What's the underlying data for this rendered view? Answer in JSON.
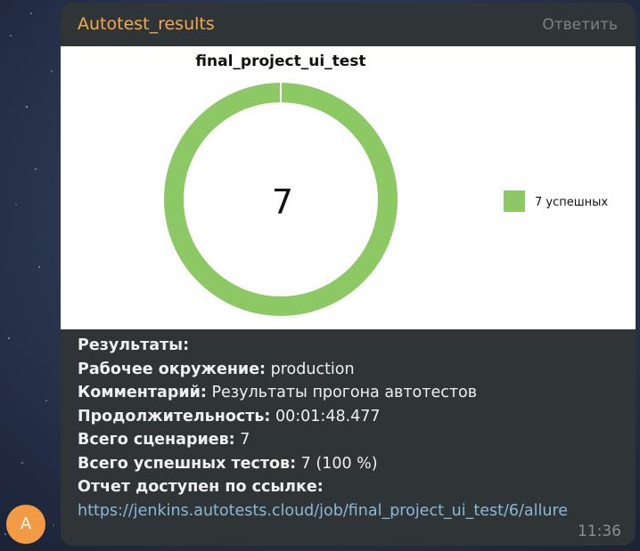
{
  "message": {
    "sender": "Autotest_results",
    "reply_label": "Ответить",
    "time": "11:36",
    "avatar_letter": "A",
    "avatar_color": "#f39a44",
    "sender_color": "#f4a94c"
  },
  "chart_data": {
    "type": "pie",
    "title": "final_project_ui_test",
    "center_label": "7",
    "series": [
      {
        "name": "7 успешных",
        "values": [
          7
        ],
        "color": "#8cc864"
      }
    ],
    "legend": [
      "7 успешных"
    ],
    "legend_position": "right"
  },
  "report": {
    "results_label": "Результаты:",
    "environment_label": "Рабочее окружение:",
    "environment_value": " production",
    "comment_label": "Комментарий:",
    "comment_value": " Результаты прогона автотестов",
    "duration_label": "Продолжительность:",
    "duration_value": " 00:01:48.477",
    "total_label": "Всего сценариев:",
    "total_value": " 7",
    "passed_label": "Всего успешных тестов:",
    "passed_value": " 7 (100 %)",
    "link_label": "Отчет доступен по ссылке:",
    "link_url": "https://jenkins.autotests.cloud/job/final_project_ui_test/6/allure"
  }
}
